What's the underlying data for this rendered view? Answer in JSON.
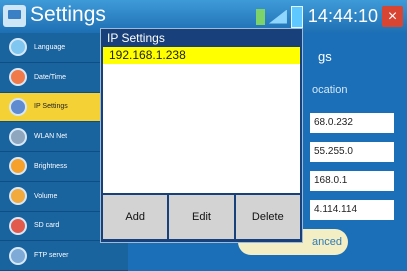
{
  "titlebar": {
    "title": "Settings",
    "time": "14:44:10",
    "close_glyph": "×"
  },
  "sidebar": {
    "items": [
      {
        "label": "Language",
        "icon": "language-icon",
        "color": "#7fc6f1",
        "active": false
      },
      {
        "label": "Date/Time",
        "icon": "calendar-icon",
        "color": "#f17a4a",
        "active": false
      },
      {
        "label": "IP Settings",
        "icon": "network-icon",
        "color": "#5f8bd0",
        "active": true
      },
      {
        "label": "WLAN Net",
        "icon": "wlan-icon",
        "color": "#8ea7bf",
        "active": false
      },
      {
        "label": "Brightness",
        "icon": "brightness-icon",
        "color": "#f6a12b",
        "active": false
      },
      {
        "label": "Volume",
        "icon": "volume-icon",
        "color": "#f2a93d",
        "active": false
      },
      {
        "label": "SD card",
        "icon": "sdcard-icon",
        "color": "#e25a4c",
        "active": false
      },
      {
        "label": "FTP server",
        "icon": "ftp-icon",
        "color": "#7eaad8",
        "active": false
      }
    ]
  },
  "content": {
    "heading_fragment": "gs",
    "sub_fragment": "ocation",
    "values": [
      "68.0.232",
      "55.255.0",
      "168.0.1",
      "4.114.114"
    ],
    "advanced_fragment": "anced"
  },
  "dialog": {
    "title": "IP Settings",
    "items": [
      "192.168.1.238"
    ],
    "selected_index": 0,
    "buttons": {
      "add": "Add",
      "edit": "Edit",
      "delete": "Delete"
    }
  }
}
